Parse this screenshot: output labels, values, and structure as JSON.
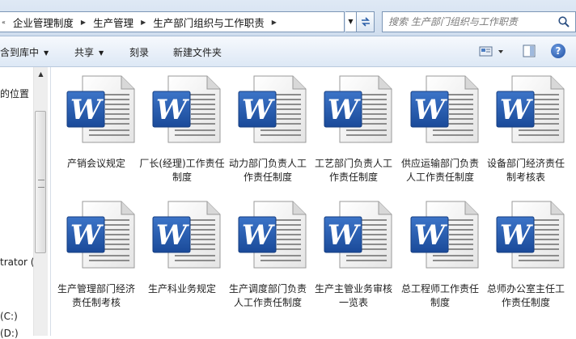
{
  "address_bar": {
    "breadcrumbs": [
      "企业管理制度",
      "生产管理",
      "生产部门组织与工作职责"
    ],
    "search_placeholder": "搜索 生产部门组织与工作职责"
  },
  "toolbar": {
    "include_in_library": "含到库中",
    "share": "共享",
    "burn": "刻录",
    "new_folder": "新建文件夹"
  },
  "nav_pane": {
    "items": [
      "的位置",
      "trator (l",
      "(C:)",
      "(D:)"
    ]
  },
  "files": [
    {
      "label": "产销会议规定",
      "icon": "word-document-icon"
    },
    {
      "label": "厂长(经理)工作责任制度",
      "icon": "word-document-icon"
    },
    {
      "label": "动力部门负责人工作责任制度",
      "icon": "word-document-icon"
    },
    {
      "label": "工艺部门负责人工作责任制度",
      "icon": "word-document-icon"
    },
    {
      "label": "供应运输部门负责人工作责任制度",
      "icon": "word-document-icon"
    },
    {
      "label": "设备部门经济责任制考核表",
      "icon": "word-document-icon"
    },
    {
      "label": "生产管理部门经济责任制考核",
      "icon": "word-document-icon"
    },
    {
      "label": "生产科业务规定",
      "icon": "word-document-icon"
    },
    {
      "label": "生产调度部门负责人工作责任制度",
      "icon": "word-document-icon"
    },
    {
      "label": "生产主管业务审核一览表",
      "icon": "word-document-icon"
    },
    {
      "label": "总工程师工作责任制度",
      "icon": "word-document-icon"
    },
    {
      "label": "总师办公室主任工作责任制度",
      "icon": "word-document-icon"
    }
  ],
  "colors": {
    "word_blue": "#1f56a8",
    "chrome_top": "#dfe9f5",
    "chrome_border": "#7c96b6"
  }
}
